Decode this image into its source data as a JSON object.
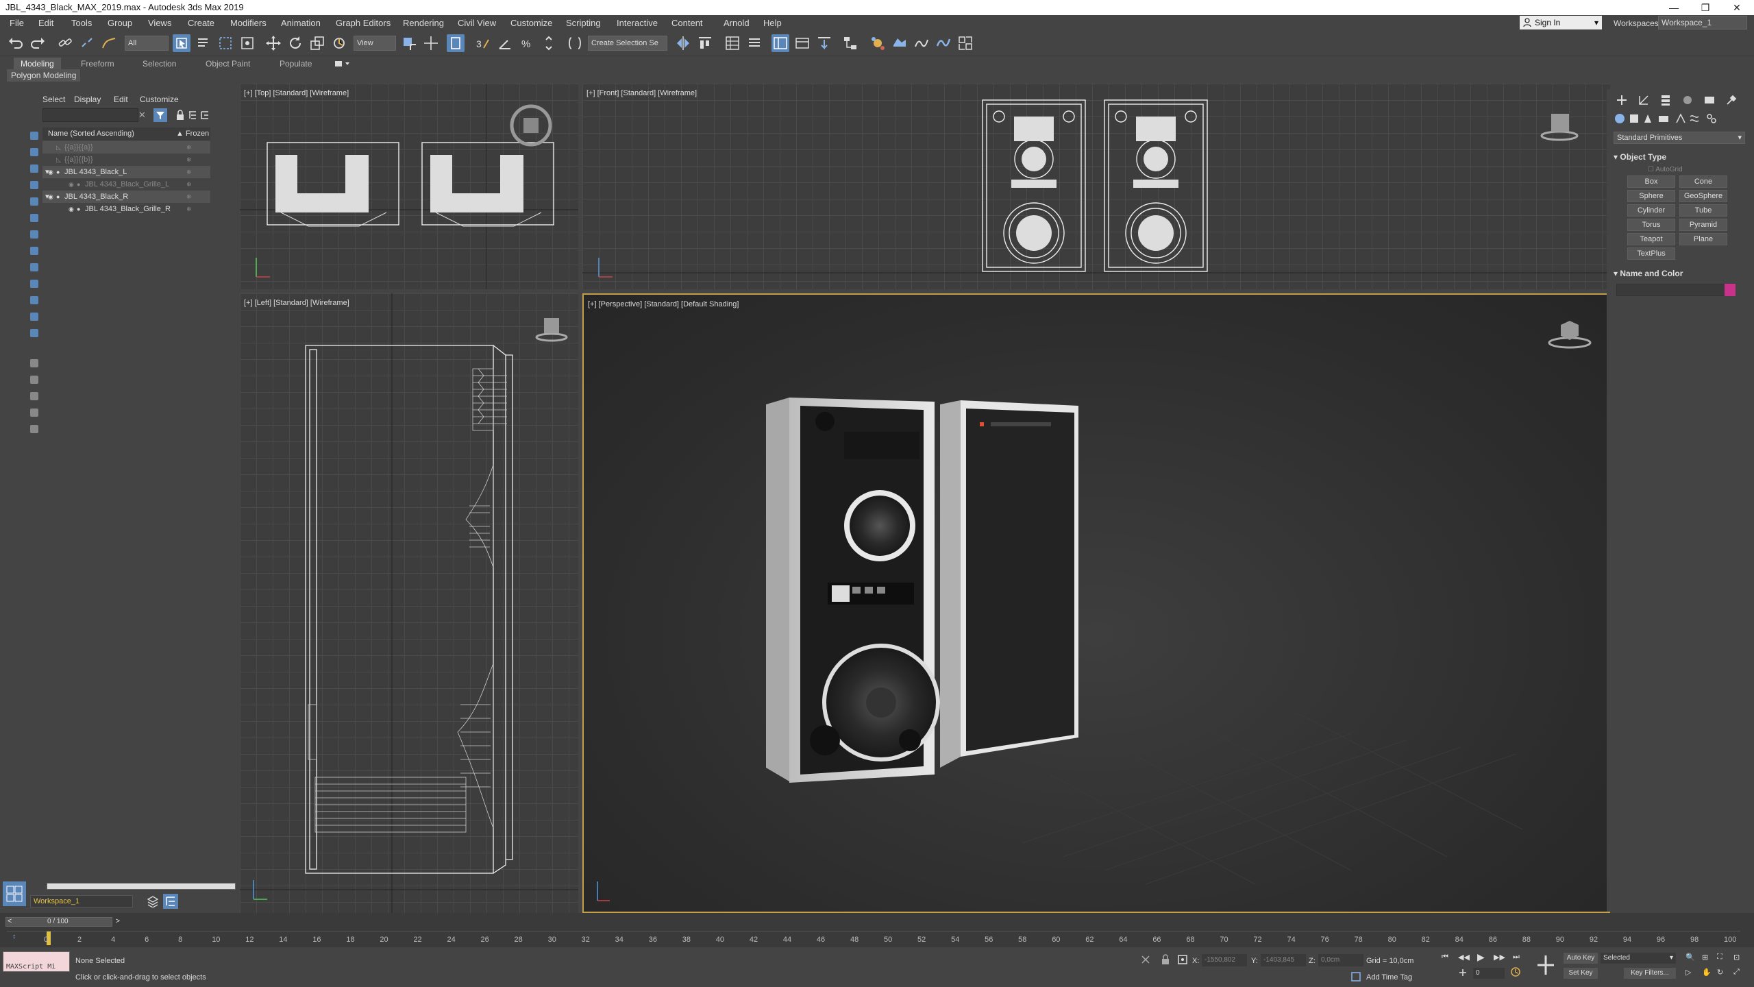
{
  "window": {
    "title": "JBL_4343_Black_MAX_2019.max - Autodesk 3ds Max 2019",
    "minimize": "—",
    "maximize": "❐",
    "close": "✕"
  },
  "menu": [
    "File",
    "Edit",
    "Tools",
    "Group",
    "Views",
    "Create",
    "Modifiers",
    "Animation",
    "Graph Editors",
    "Rendering",
    "Civil View",
    "Customize",
    "Scripting",
    "Interactive",
    "Content",
    "Arnold",
    "Help"
  ],
  "account": {
    "sign_in": "Sign In",
    "workspaces_label": "Workspaces:",
    "workspace": "Workspace_1"
  },
  "toolbar": {
    "filter_select": "All",
    "view_select": "View",
    "selection_set": "Create Selection Se"
  },
  "ribbon": {
    "tabs": [
      "Modeling",
      "Freeform",
      "Selection",
      "Object Paint",
      "Populate"
    ],
    "active": "Modeling",
    "panel": "Polygon Modeling"
  },
  "explorer": {
    "tabs": [
      "Select",
      "Display",
      "Edit",
      "Customize"
    ],
    "col_name": "Name (Sorted Ascending)",
    "col_frozen": "▲ Frozen",
    "rows": [
      {
        "label": "{{a}}{{a}}",
        "indent": 0,
        "dim": true
      },
      {
        "label": "{{a}}{{b}}",
        "indent": 0,
        "dim": true
      },
      {
        "label": "JBL 4343_Black_L",
        "indent": 0,
        "dim": false
      },
      {
        "label": "JBL 4343_Black_Grille_L",
        "indent": 1,
        "dim": true
      },
      {
        "label": "JBL 4343_Black_R",
        "indent": 0,
        "dim": false
      },
      {
        "label": "JBL 4343_Black_Grille_R",
        "indent": 1,
        "dim": false
      }
    ],
    "workspace": "Workspace_1"
  },
  "viewports": {
    "top": "[+] [Top] [Standard] [Wireframe]",
    "front": "[+] [Front] [Standard] [Wireframe]",
    "left": "[+] [Left] [Standard] [Wireframe]",
    "persp": "[+] [Perspective] [Standard] [Default Shading]"
  },
  "command_panel": {
    "dropdown": "Standard Primitives",
    "object_type": "Object Type",
    "autogrid": "AutoGrid",
    "buttons": [
      "Box",
      "Cone",
      "Sphere",
      "GeoSphere",
      "Cylinder",
      "Tube",
      "Torus",
      "Pyramid",
      "Teapot",
      "Plane",
      "TextPlus"
    ],
    "name_color": "Name and Color",
    "swatch_color": "#c8328a"
  },
  "timeline": {
    "frame": "0 / 100",
    "ticks": [
      "0",
      "2",
      "4",
      "6",
      "8",
      "10",
      "12",
      "14",
      "16",
      "18",
      "20",
      "22",
      "24",
      "26",
      "28",
      "30",
      "32",
      "34",
      "36",
      "38",
      "40",
      "42",
      "44",
      "46",
      "48",
      "50",
      "52",
      "54",
      "56",
      "58",
      "60",
      "62",
      "64",
      "66",
      "68",
      "70",
      "72",
      "74",
      "76",
      "78",
      "80",
      "82",
      "84",
      "86",
      "88",
      "90",
      "92",
      "94",
      "96",
      "98",
      "100"
    ]
  },
  "status": {
    "maxscript": "MAXScript Mi",
    "selection": "None Selected",
    "prompt": "Click or click-and-drag to select objects",
    "x_label": "X:",
    "x_val": "-1550,802",
    "y_label": "Y:",
    "y_val": "-1403,845",
    "z_label": "Z:",
    "z_val": "0,0cm",
    "grid": "Grid = 10,0cm",
    "add_time_tag": "Add Time Tag",
    "auto_key": "Auto Key",
    "selected": "Selected",
    "set_key": "Set Key",
    "key_filters": "Key Filters...",
    "frame_field": "0"
  }
}
